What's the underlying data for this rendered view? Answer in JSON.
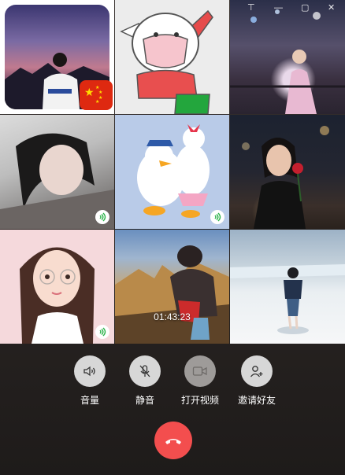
{
  "window": {
    "controls": {
      "pin": "⊤",
      "minimize": "—",
      "maximize": "▢",
      "close": "✕"
    }
  },
  "call": {
    "timer": "01:43:23"
  },
  "participants": [
    {
      "id": "p1",
      "speaking": false,
      "photo_badge": "China flag"
    },
    {
      "id": "p2",
      "speaking": false
    },
    {
      "id": "p3",
      "speaking": false
    },
    {
      "id": "p4",
      "speaking": true
    },
    {
      "id": "p5",
      "speaking": true
    },
    {
      "id": "p6",
      "speaking": false
    },
    {
      "id": "p7",
      "speaking": true
    },
    {
      "id": "p8",
      "speaking": false
    },
    {
      "id": "p9",
      "speaking": false
    }
  ],
  "controls": {
    "volume_label": "音量",
    "mute_label": "静音",
    "video_label": "打开视频",
    "invite_label": "邀请好友"
  },
  "colors": {
    "hangup": "#f34e4e",
    "speaking": "#2bb34a",
    "button_bg": "#d7d7d7"
  }
}
